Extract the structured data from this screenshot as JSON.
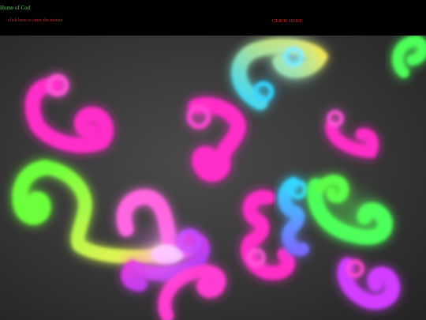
{
  "header": {
    "site_title": "Home of Cod",
    "matrix_link": "click here to enter the matrix",
    "click_here": "CLICK HERE"
  },
  "canvas": {
    "description_icon": "fluid-swirl-simulation",
    "colors": {
      "magenta": "#ff2fc8",
      "pink": "#ff3cd2",
      "cyan": "#35d6ff",
      "green": "#4dff5a",
      "yellow": "#ffe84a",
      "violet": "#b93cff",
      "white": "#fff4ff"
    }
  }
}
